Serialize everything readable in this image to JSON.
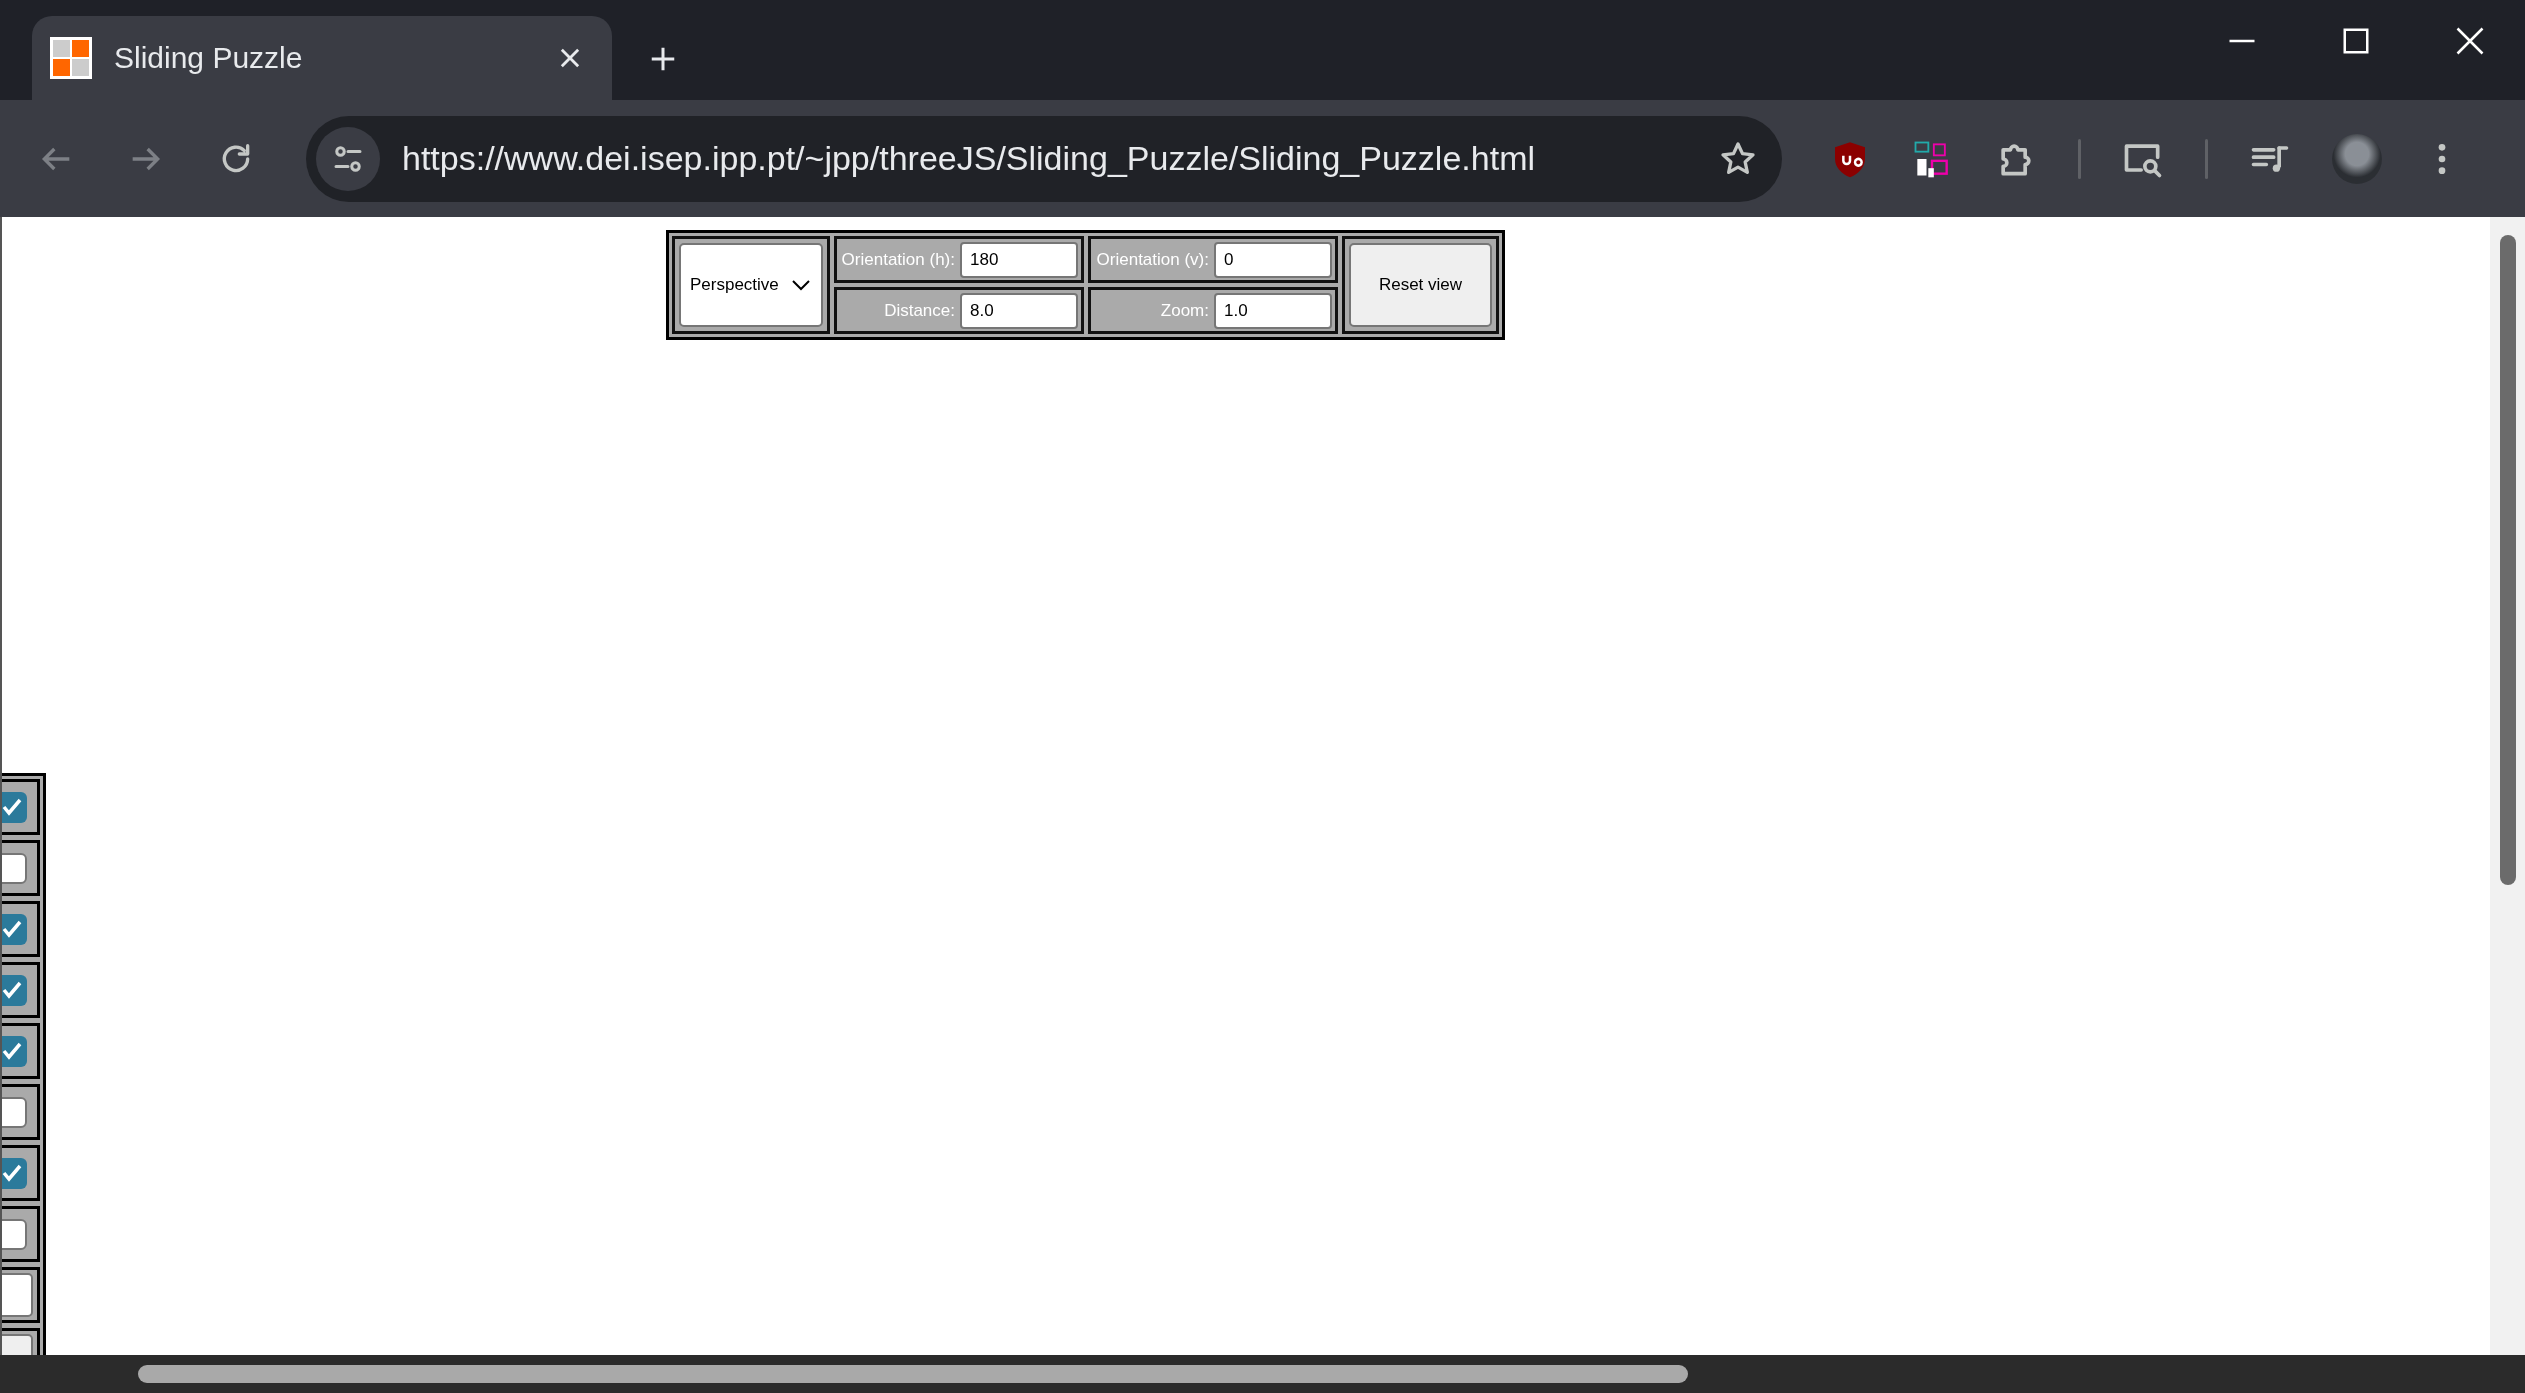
{
  "browser": {
    "tab": {
      "title": "Sliding Puzzle"
    },
    "url": "https://www.dei.isep.ipp.pt/~jpp/threeJS/Sliding_Puzzle/Sliding_Puzzle.html"
  },
  "view_controls": {
    "projection": "Perspective",
    "fields": [
      {
        "label": "Orientation (h):",
        "value": "180"
      },
      {
        "label": "Orientation (v):",
        "value": "0"
      },
      {
        "label": "Distance:",
        "value": "8.0"
      },
      {
        "label": "Zoom:",
        "value": "1.0"
      }
    ],
    "reset_button": "Reset view"
  },
  "side_controls": [
    {
      "kind": "checkbox",
      "checked": true
    },
    {
      "kind": "checkbox",
      "checked": false
    },
    {
      "kind": "checkbox",
      "checked": true
    },
    {
      "kind": "checkbox",
      "checked": true
    },
    {
      "kind": "checkbox",
      "checked": true
    },
    {
      "kind": "checkbox",
      "checked": false
    },
    {
      "kind": "checkbox",
      "checked": true
    },
    {
      "kind": "checkbox",
      "checked": false
    },
    {
      "kind": "field"
    },
    {
      "kind": "button"
    }
  ]
}
